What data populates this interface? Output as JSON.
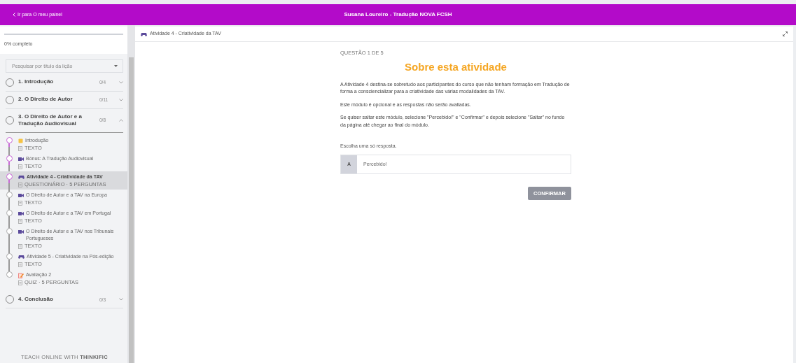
{
  "header": {
    "back_link": "Ir para O meu painel",
    "title": "Susana Loureiro - Tradução NOVA FCSH"
  },
  "sidebar": {
    "progress": {
      "level": 0,
      "label": "0% completo"
    },
    "search": {
      "placeholder": "Pesquisar por título da lição"
    },
    "chapters": [
      {
        "title": "1. Introdução",
        "count": "0/4",
        "expanded": false
      },
      {
        "title": "2. O Direito de Autor",
        "count": "0/11",
        "expanded": false
      },
      {
        "title": "3. O Direito de Autor e a Tradução Audiovisual",
        "count": "0/8",
        "expanded": true,
        "lessons": [
          {
            "kind": "note",
            "title": "Introdução",
            "meta": "TEXTO",
            "viewed": true,
            "selected": false
          },
          {
            "kind": "video",
            "title": "Bónus: A Tradução Audiovisual",
            "meta": "TEXTO",
            "viewed": true,
            "selected": false
          },
          {
            "kind": "game",
            "title": "Atividade 4 - Criatividade da TAV",
            "meta": "QUESTIONÁRIO · 5 PERGUNTAS",
            "viewed": true,
            "selected": true
          },
          {
            "kind": "video",
            "title": "O Direito de Autor e a TAV na Europa",
            "meta": "TEXTO",
            "viewed": false,
            "selected": false
          },
          {
            "kind": "video",
            "title": "O Direito de Autor e a TAV em Portugal",
            "meta": "TEXTO",
            "viewed": false,
            "selected": false
          },
          {
            "kind": "video",
            "title": "O Direito de Autor e a TAV nos Tribunais Portugueses",
            "meta": "TEXTO",
            "viewed": false,
            "selected": false
          },
          {
            "kind": "game",
            "title": "Atividade 5 - Criatividade na Pós-edição",
            "meta": "TEXTO",
            "viewed": false,
            "selected": false
          },
          {
            "kind": "quiz",
            "title": "Avaliação 2",
            "meta": "QUIZ · 5 PERGUNTAS",
            "viewed": false,
            "selected": false
          }
        ]
      },
      {
        "title": "4. Conclusão",
        "count": "0/3",
        "expanded": false
      }
    ],
    "footer": {
      "prefix": "TEACH ONLINE WITH",
      "brand": "THINKIFIC"
    }
  },
  "content": {
    "lesson_title": "Atividade 4 - Criatividade da TAV",
    "question_counter": "QUESTÃO 1 DE 5",
    "heading": "Sobre esta atividade",
    "paragraphs": [
      "A Atividade 4 destina-se sobretudo aos participantes do curso que não tenham formação em Tradução de forma a consciencializar para a criatividade das várias modalidades da TAV.",
      "Este módulo é opcional e as respostas não serão avaliadas.",
      "Se quiser saltar este módulo, selecione \"Percebido!\" e \"Confirmar\" e depois selecione \"Saltar\" no fundo da página até chegar ao final do módulo."
    ],
    "instruction": "Escolha uma só resposta.",
    "answers": [
      {
        "letter": "A",
        "text": "Percebido!",
        "selected": false
      }
    ],
    "submit": {
      "label": "CONFIRMAR",
      "disabled": true
    }
  }
}
